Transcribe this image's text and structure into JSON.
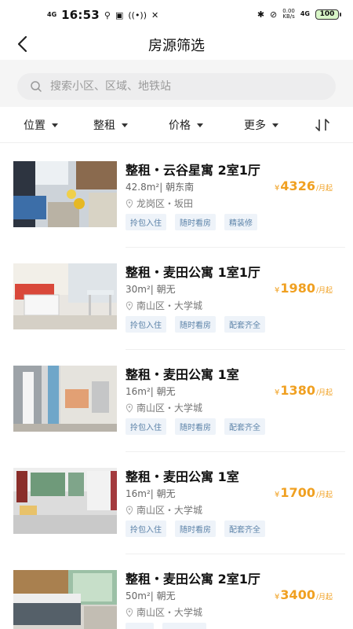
{
  "status_bar": {
    "network": "4G",
    "time": "16:53",
    "net_speed_value": "0.00",
    "net_speed_unit": "KB/s",
    "network_right": "4G",
    "battery": "100"
  },
  "header": {
    "title": "房源筛选"
  },
  "search": {
    "placeholder": "搜索小区、区域、地铁站"
  },
  "filters": {
    "location": "位置",
    "rent_type": "整租",
    "price": "价格",
    "more": "更多"
  },
  "price_currency": "¥",
  "price_unit": "/月起",
  "listings": [
    {
      "title": "整租・云谷星寓 2室1厅",
      "size": "42.8m²| 朝东南",
      "location": "龙岗区・坂田",
      "price": "4326",
      "tags": [
        "拎包入住",
        "随时看房",
        "精装修"
      ]
    },
    {
      "title": "整租・麦田公寓 1室1厅",
      "size": "30m²| 朝无",
      "location": "南山区・大学城",
      "price": "1980",
      "tags": [
        "拎包入住",
        "随时看房",
        "配套齐全"
      ]
    },
    {
      "title": "整租・麦田公寓 1室",
      "size": "16m²| 朝无",
      "location": "南山区・大学城",
      "price": "1380",
      "tags": [
        "拎包入住",
        "随时看房",
        "配套齐全"
      ]
    },
    {
      "title": "整租・麦田公寓 1室",
      "size": "16m²| 朝无",
      "location": "南山区・大学城",
      "price": "1700",
      "tags": [
        "拎包入住",
        "随时看房",
        "配套齐全"
      ]
    },
    {
      "title": "整租・麦田公寓 2室1厅",
      "size": "50m²| 朝无",
      "location": "南山区・大学城",
      "price": "3400",
      "tags": [
        "",
        ""
      ]
    }
  ]
}
